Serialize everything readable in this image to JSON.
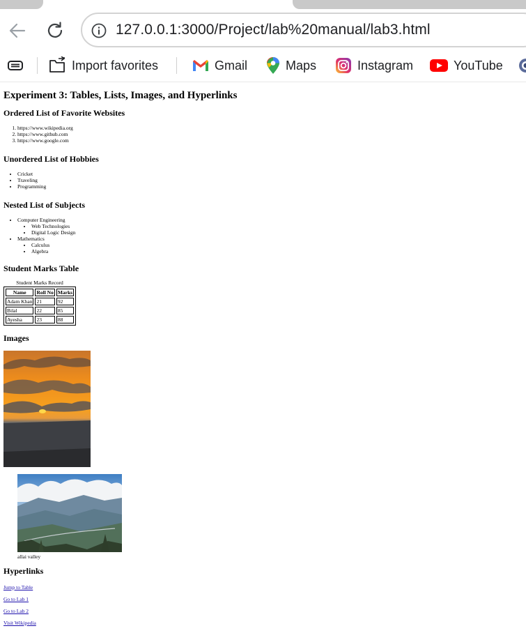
{
  "browser": {
    "url": "127.0.0.1:3000/Project/lab%20manual/lab3.html",
    "bookmarks": [
      "Import favorites",
      "Gmail",
      "Maps",
      "Instagram",
      "YouTube"
    ]
  },
  "page": {
    "title": "Experiment 3: Tables, Lists, Images, and Hyperlinks",
    "ordered": {
      "heading": "Ordered List of Favorite Websites",
      "items": [
        "https://www.wikipedia.org",
        "https://www.github.com",
        "https://www.google.com"
      ]
    },
    "unordered": {
      "heading": "Unordered List of Hobbies",
      "items": [
        "Cricket",
        "Traveling",
        "Programming"
      ]
    },
    "nested": {
      "heading": "Nested List of Subjects",
      "groups": [
        {
          "label": "Computer Engineering",
          "items": [
            "Web Technologies",
            "Digital Logic Design"
          ]
        },
        {
          "label": "Mathematics",
          "items": [
            "Calculus",
            "Algebra"
          ]
        }
      ]
    },
    "table": {
      "heading": "Student Marks Table",
      "caption": "Student Marks Record",
      "headers": [
        "Name",
        "Roll No",
        "Marks"
      ],
      "rows": [
        [
          "Adam Khan",
          "21",
          "92"
        ],
        [
          "Bilal",
          "22",
          "85"
        ],
        [
          "Ayesha",
          "23",
          "88"
        ]
      ]
    },
    "images": {
      "heading": "Images",
      "caption": "allai valley"
    },
    "links": {
      "heading": "Hyperlinks",
      "items": [
        "Jump to Table",
        "Go to Lab 1",
        "Go to Lab 2",
        "Visit Wikipedia"
      ]
    }
  },
  "colors": {
    "link": "#1a0dab",
    "youtube": "#ff0000",
    "gmail_red": "#ea4335"
  },
  "icons": [
    "back-arrow-icon",
    "reload-icon",
    "site-info-icon",
    "collections-icon",
    "import-favorites-icon",
    "gmail-icon",
    "maps-icon",
    "instagram-icon",
    "youtube-icon",
    "profile-icon"
  ]
}
